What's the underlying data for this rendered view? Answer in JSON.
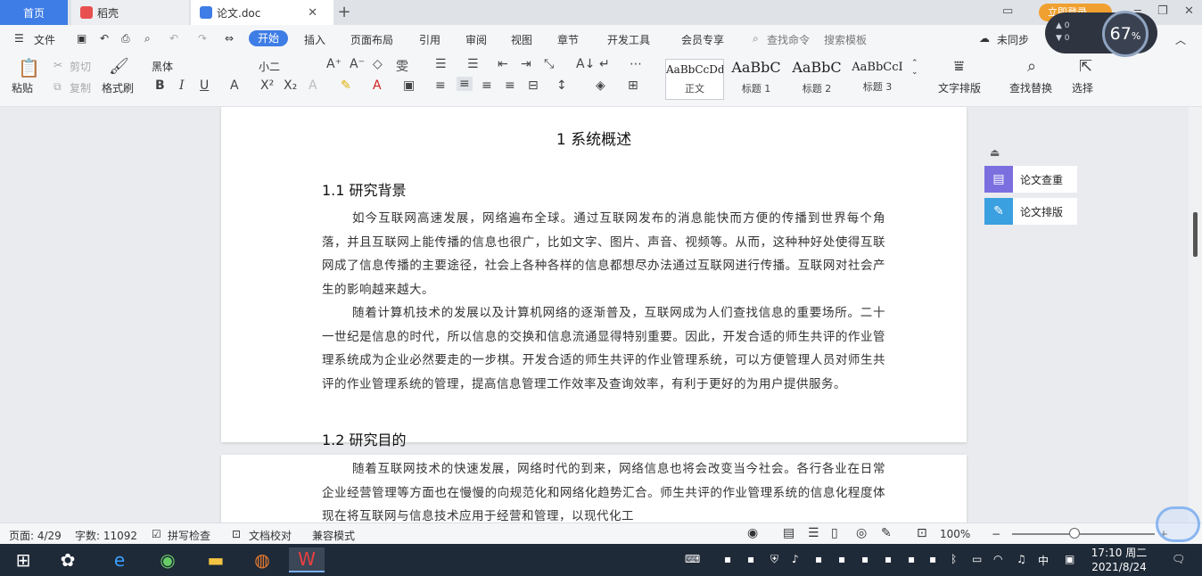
{
  "tabs": {
    "home": "首页",
    "daoke": "稻壳",
    "doc": "论文.doc"
  },
  "window": {
    "login": "立即登录"
  },
  "menu": {
    "file": "文件",
    "items": [
      "开始",
      "插入",
      "页面布局",
      "引用",
      "审阅",
      "视图",
      "章节",
      "开发工具",
      "会员专享"
    ],
    "search": "查找命令",
    "search_template": "搜索模板",
    "sync": "未同步"
  },
  "ribbon": {
    "paste": "粘贴",
    "cut": "剪切",
    "copy": "复制",
    "format_painter": "格式刷",
    "font_name": "黑体",
    "font_size": "小二",
    "styles": [
      {
        "sample": "AaBbCcDd",
        "label": "正文"
      },
      {
        "sample": "AaBbC",
        "label": "标题 1"
      },
      {
        "sample": "AaBbC",
        "label": "标题 2"
      },
      {
        "sample": "AaBbCcI",
        "label": "标题 3"
      }
    ],
    "text_layout": "文字排版",
    "find_replace": "查找替换",
    "select": "选择"
  },
  "document": {
    "heading1": "1 系统概述",
    "sec1_title": "1.1  研究背景",
    "sec1_p1": "如今互联网高速发展，网络遍布全球。通过互联网发布的消息能快而方便的传播到世界每个角落，并且互联网上能传播的信息也很广，比如文字、图片、声音、视频等。从而，这种种好处使得互联网成了信息传播的主要途径，社会上各种各样的信息都想尽办法通过互联网进行传播。互联网对社会产生的影响越来越大。",
    "sec1_p2": "随着计算机技术的发展以及计算机网络的逐渐普及，互联网成为人们查找信息的重要场所。二十一世纪是信息的时代，所以信息的交换和信息流通显得特别重要。因此，开发合适的师生共评的作业管理系统成为企业必然要走的一步棋。开发合适的师生共评的作业管理系统，可以方便管理人员对师生共评的作业管理系统的管理，提高信息管理工作效率及查询效率，有利于更好的为用户提供服务。",
    "sec2_title": "1.2 研究目的",
    "sec2_p1": "随着互联网技术的快速发展，网络时代的到来，网络信息也将会改变当今社会。各行各业在日常企业经营管理等方面也在慢慢的向规范化和网络化趋势汇合。师生共评的作业管理系统的信息化程度体现在将互联网与信息技术应用于经营和管理，以现代化工"
  },
  "side_panel": {
    "check": "论文查重",
    "layout": "论文排版"
  },
  "status": {
    "page": "页面: 4/29",
    "words": "字数: 11092",
    "spell": "拼写检查",
    "proof": "文档校对",
    "compat": "兼容模式",
    "zoom": "100%"
  },
  "speed_widget": {
    "up": "0",
    "down": "0",
    "percent": "67"
  },
  "clock": {
    "time": "17:10 周二",
    "date": "2021/8/24"
  },
  "ime": "中",
  "colors": {
    "accent": "#3e7de6",
    "login": "#f0a030",
    "taskbar": "#1f2a38"
  }
}
